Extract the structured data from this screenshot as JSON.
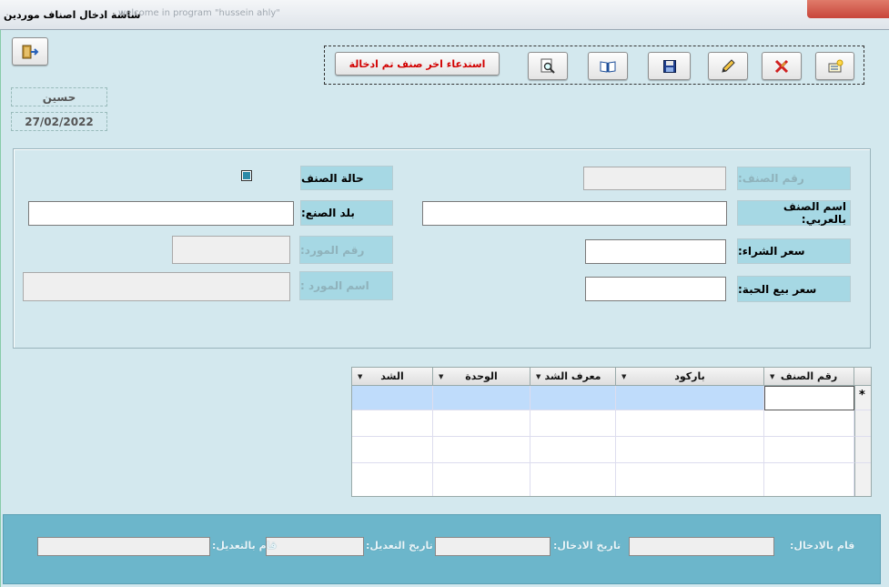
{
  "window": {
    "title": "شاشة ادخال اصناف موردين",
    "faded_text": "welcome in program \"hussein ahly\""
  },
  "toolbar": {
    "exit_icon": "exit-door-icon",
    "recall_label": "استدعاء اخر صنف تم ادخالة",
    "buttons": [
      {
        "name": "preview-button",
        "icon": "magnifier-page-icon"
      },
      {
        "name": "open-book-button",
        "icon": "book-icon"
      },
      {
        "name": "save-button",
        "icon": "floppy-disk-icon"
      },
      {
        "name": "edit-button",
        "icon": "pencil-icon"
      },
      {
        "name": "delete-button",
        "icon": "x-tools-icon"
      },
      {
        "name": "new-button",
        "icon": "new-record-icon"
      }
    ]
  },
  "user": {
    "name": "حسين",
    "date": "27/02/2022"
  },
  "form": {
    "item_number_label": "رقم الصنف:",
    "item_name_ar_label": "اسم الصنف بالعربي:",
    "purchase_price_label": "سعر الشراء:",
    "unit_sale_price_label": "سعر بيع الحبة:",
    "item_status_label": "حالة الصنف",
    "country_label": "بلد الصنع:",
    "supplier_number_label": "رقم المورد:",
    "supplier_name_label": "اسم المورد :"
  },
  "grid": {
    "columns": [
      "رقم الصنف",
      "باركود",
      "معرف الشد",
      "الوحدة",
      "الشد"
    ],
    "new_row_marker": "*"
  },
  "footer": {
    "entered_by_label": "قام بالادخال:",
    "entry_date_label": "تاريخ الادخال:",
    "modified_date_label": "تاريخ التعديل:",
    "modified_by_label": "قام بالتعديل:"
  },
  "colors": {
    "background": "#d3e8ee",
    "label_bg": "#a6d8e4",
    "footer_bg": "#6cb6cb",
    "recall_text": "#d20000",
    "selected_row": "#bfdcfb"
  }
}
